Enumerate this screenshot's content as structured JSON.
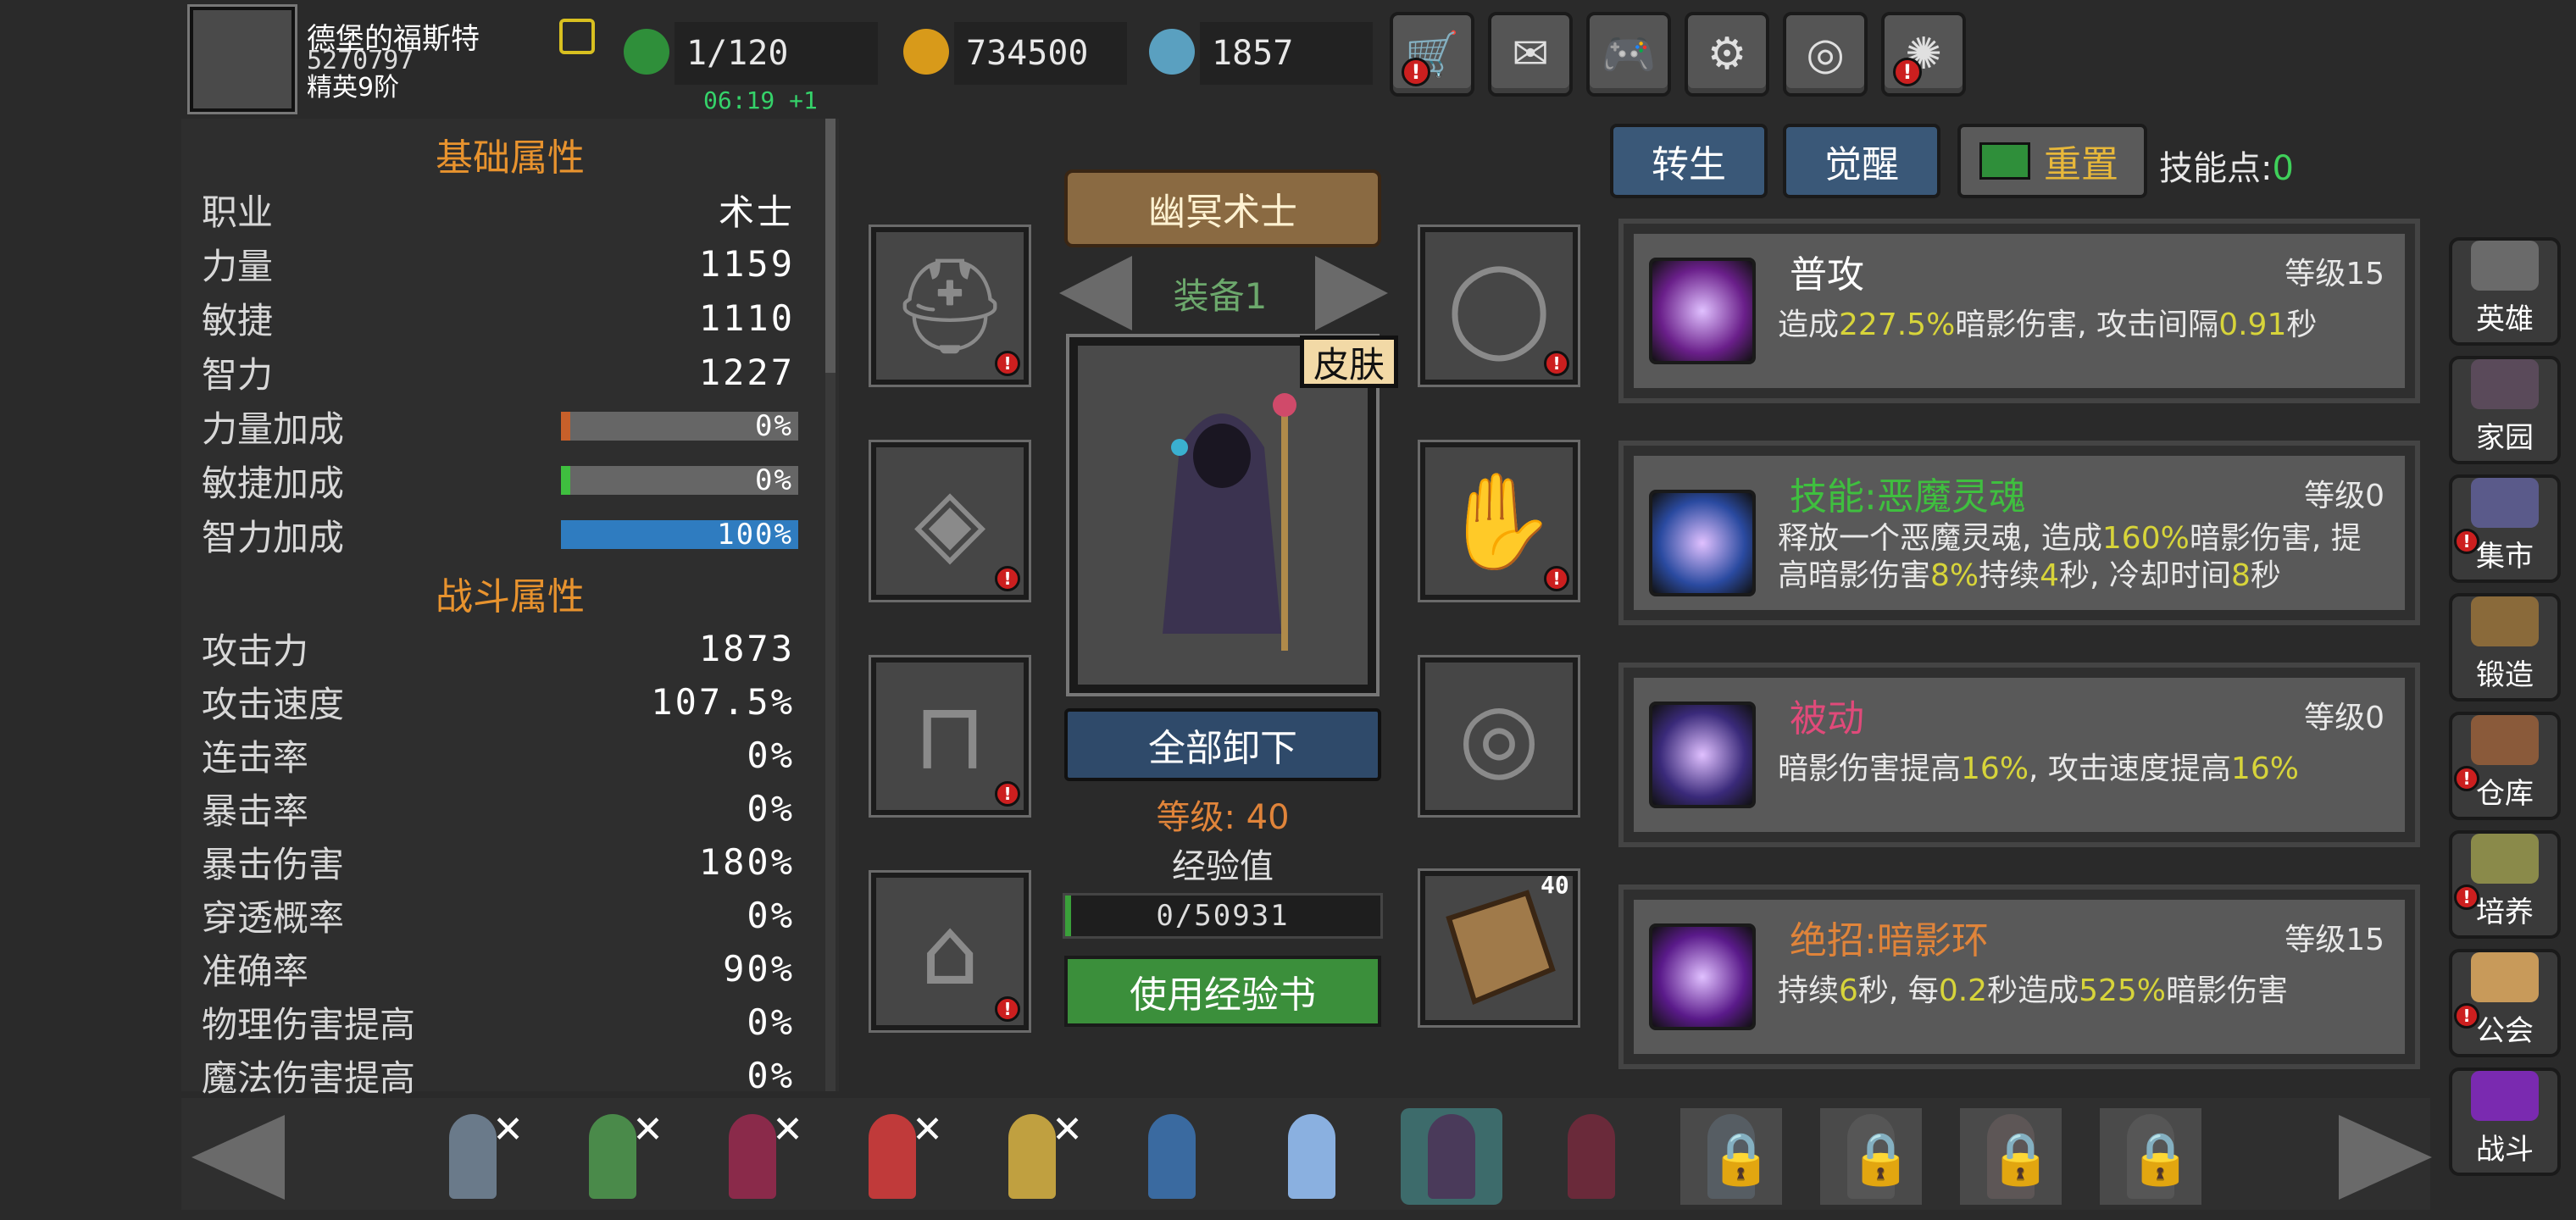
{
  "player": {
    "name": "德堡的福斯特",
    "id": "5270797",
    "rank": "精英9阶"
  },
  "resources": {
    "energy": "1/120",
    "gold": "734500",
    "gems": "1857",
    "timer": "06:19 +1"
  },
  "top_buttons": [
    {
      "name": "shop",
      "icon": "🛒",
      "alert": true
    },
    {
      "name": "mail",
      "icon": "✉",
      "alert": false
    },
    {
      "name": "gamepad",
      "icon": "🎮",
      "alert": false
    },
    {
      "name": "settings",
      "icon": "⚙",
      "alert": false
    },
    {
      "name": "color-wheel",
      "icon": "◎",
      "alert": false
    },
    {
      "name": "fireworks",
      "icon": "✺",
      "alert": true
    }
  ],
  "base_attrs": {
    "title": "基础属性",
    "rows": [
      {
        "label": "职业",
        "value": "术士"
      },
      {
        "label": "力量",
        "value": "1159"
      },
      {
        "label": "敏捷",
        "value": "1110"
      },
      {
        "label": "智力",
        "value": "1227"
      }
    ],
    "bonuses": [
      {
        "label": "力量加成",
        "value": "0%",
        "fill": 0.03,
        "color": "#c8602a"
      },
      {
        "label": "敏捷加成",
        "value": "0%",
        "fill": 0.03,
        "color": "#3fbf3f"
      },
      {
        "label": "智力加成",
        "value": "100%",
        "fill": 1.0,
        "color": "#2f7cc0"
      }
    ]
  },
  "combat_attrs": {
    "title": "战斗属性",
    "rows": [
      {
        "label": "攻击力",
        "value": "1873"
      },
      {
        "label": "攻击速度",
        "value": "107.5%"
      },
      {
        "label": "连击率",
        "value": "0%"
      },
      {
        "label": "暴击率",
        "value": "0%"
      },
      {
        "label": "暴击伤害",
        "value": "180%"
      },
      {
        "label": "穿透概率",
        "value": "0%"
      },
      {
        "label": "准确率",
        "value": "90%"
      },
      {
        "label": "物理伤害提高",
        "value": "0%"
      },
      {
        "label": "魔法伤害提高",
        "value": "0%"
      }
    ]
  },
  "equipment": {
    "class_title": "幽冥术士",
    "set_label": "装备1",
    "skin_label": "皮肤",
    "unequip_label": "全部卸下",
    "level_label": "等级: 40",
    "exp_label": "经验值",
    "exp_value": "0/50931",
    "exp_fill": 0.0,
    "use_book_label": "使用经验书",
    "book_count": "40",
    "slots_left": [
      {
        "name": "helmet",
        "icon": "⛑"
      },
      {
        "name": "armor",
        "icon": "◈"
      },
      {
        "name": "leggings",
        "icon": "⊓"
      },
      {
        "name": "boots",
        "icon": "⌂"
      }
    ],
    "slots_right": [
      {
        "name": "necklace",
        "icon": "◯"
      },
      {
        "name": "gloves",
        "icon": "✋"
      },
      {
        "name": "ring",
        "icon": "◎"
      }
    ]
  },
  "skill_tabs": {
    "rebirth": "转生",
    "awaken": "觉醒",
    "reset": "重置",
    "points_label": "技能点:",
    "points_value": "0"
  },
  "skills": [
    {
      "name": "普攻",
      "name_color": "#ffffff",
      "level": "等级15",
      "desc": [
        [
          "造成",
          ""
        ],
        [
          "227.5%",
          "hl"
        ],
        [
          "暗影伤害, 攻击间隔",
          ""
        ],
        [
          "0.91",
          "hl"
        ],
        [
          "秒",
          ""
        ]
      ],
      "icon_color": "#6a1f8a"
    },
    {
      "name": "技能:恶魔灵魂",
      "name_color": "#3fbf3f",
      "level": "等级0",
      "desc": [
        [
          "释放一个恶魔灵魂, 造成",
          ""
        ],
        [
          "160%",
          "hl"
        ],
        [
          "暗影伤害, 提高暗影伤害",
          ""
        ],
        [
          "8%",
          "hl"
        ],
        [
          "持续",
          ""
        ],
        [
          "4",
          "hl"
        ],
        [
          "秒, 冷却时间",
          ""
        ],
        [
          "8",
          "hl"
        ],
        [
          "秒",
          ""
        ]
      ],
      "icon_color": "#2a4aa0"
    },
    {
      "name": "被动",
      "name_color": "#e04a7a",
      "level": "等级0",
      "desc": [
        [
          "暗影伤害提高",
          ""
        ],
        [
          "16%",
          "hl"
        ],
        [
          ", 攻击速度提高",
          ""
        ],
        [
          "16%",
          "hl"
        ]
      ],
      "icon_color": "#3a2a7a"
    },
    {
      "name": "绝招:暗影环",
      "name_color": "#e0843a",
      "level": "等级15",
      "desc": [
        [
          "持续",
          ""
        ],
        [
          "6",
          "hl"
        ],
        [
          "秒, 每",
          ""
        ],
        [
          "0.2",
          "hl"
        ],
        [
          "秒造成",
          ""
        ],
        [
          "525%",
          "hl"
        ],
        [
          "暗影伤害",
          ""
        ]
      ],
      "icon_color": "#5a1a8a"
    }
  ],
  "nav": [
    {
      "label": "英雄",
      "alert": false,
      "color": "#6a6a6a"
    },
    {
      "label": "家园",
      "alert": false,
      "color": "#5a4a5a"
    },
    {
      "label": "集市",
      "alert": true,
      "color": "#5a5a8a"
    },
    {
      "label": "锻造",
      "alert": false,
      "color": "#8a6a3a"
    },
    {
      "label": "仓库",
      "alert": true,
      "color": "#8a5a3a"
    },
    {
      "label": "培养",
      "alert": true,
      "color": "#8a8a4a"
    },
    {
      "label": "公会",
      "alert": true,
      "color": "#c89a5a"
    },
    {
      "label": "战斗",
      "alert": false,
      "color": "#7a2ab0"
    }
  ],
  "heroes": [
    {
      "color": "#6a7a8a",
      "state": "x"
    },
    {
      "color": "#4a8a4a",
      "state": "x"
    },
    {
      "color": "#8a2a4a",
      "state": "x"
    },
    {
      "color": "#c03a3a",
      "state": "x"
    },
    {
      "color": "#c0a040",
      "state": "x"
    },
    {
      "color": "#3a6aa0",
      "state": ""
    },
    {
      "color": "#8ab0e0",
      "state": ""
    },
    {
      "color": "#4a3a5a",
      "state": "sel"
    },
    {
      "color": "#6a2a3a",
      "state": ""
    },
    {
      "color": "#6a7a8a",
      "state": "lock"
    },
    {
      "color": "#6a6a6a",
      "state": "lock"
    },
    {
      "color": "#7a6a6a",
      "state": "lock"
    },
    {
      "color": "#6a6a6a",
      "state": "lock"
    }
  ]
}
